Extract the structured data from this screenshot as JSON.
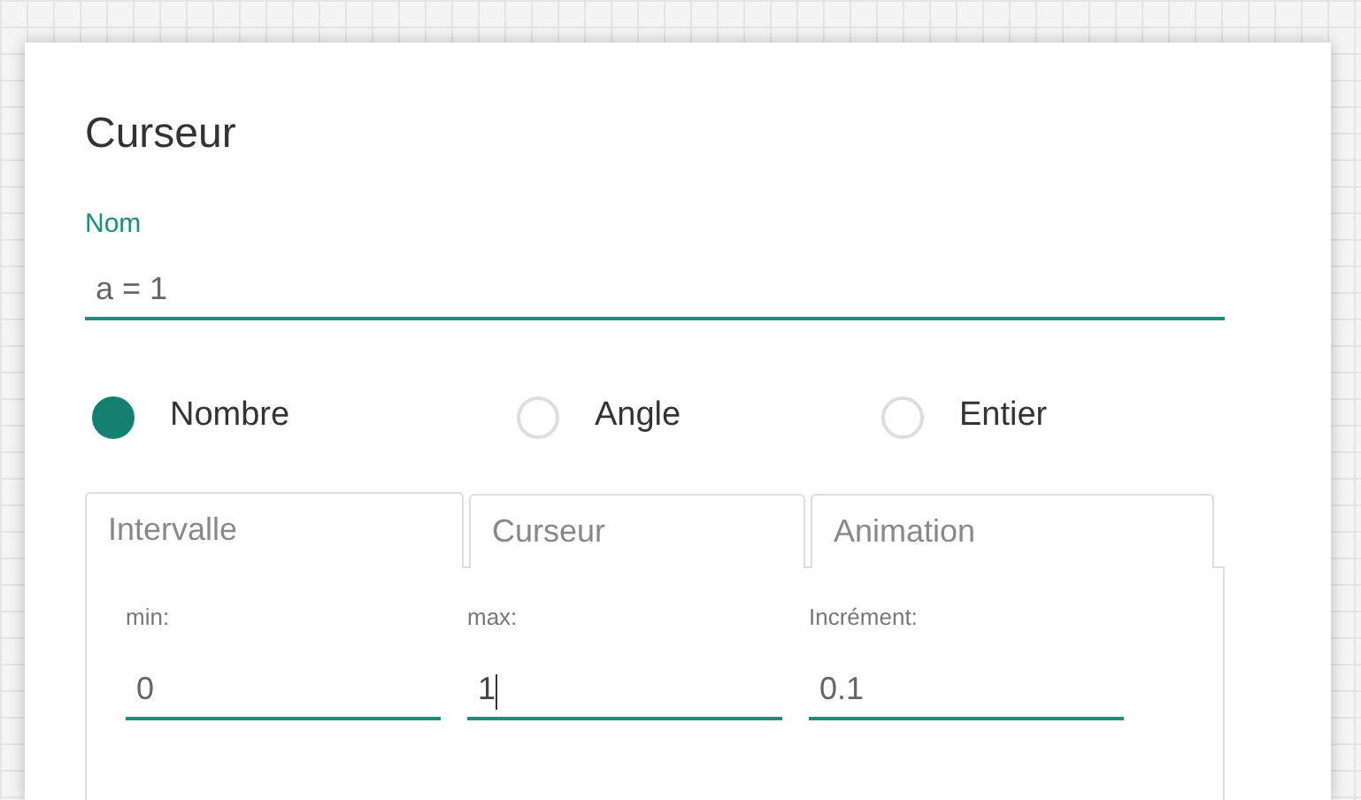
{
  "dialog": {
    "title": "Curseur"
  },
  "name_field": {
    "label": "Nom",
    "value": "a = 1"
  },
  "types": [
    {
      "label": "Nombre",
      "selected": true
    },
    {
      "label": "Angle",
      "selected": false
    },
    {
      "label": "Entier",
      "selected": false
    }
  ],
  "tabs": [
    {
      "label": "Intervalle",
      "selected": true
    },
    {
      "label": "Curseur",
      "selected": false
    },
    {
      "label": "Animation",
      "selected": false
    }
  ],
  "fields": [
    {
      "label": "min:",
      "value": "0",
      "focused": false
    },
    {
      "label": "max:",
      "value": "1",
      "focused": true
    },
    {
      "label": "Incrément:",
      "value": "0.1",
      "focused": false
    }
  ]
}
